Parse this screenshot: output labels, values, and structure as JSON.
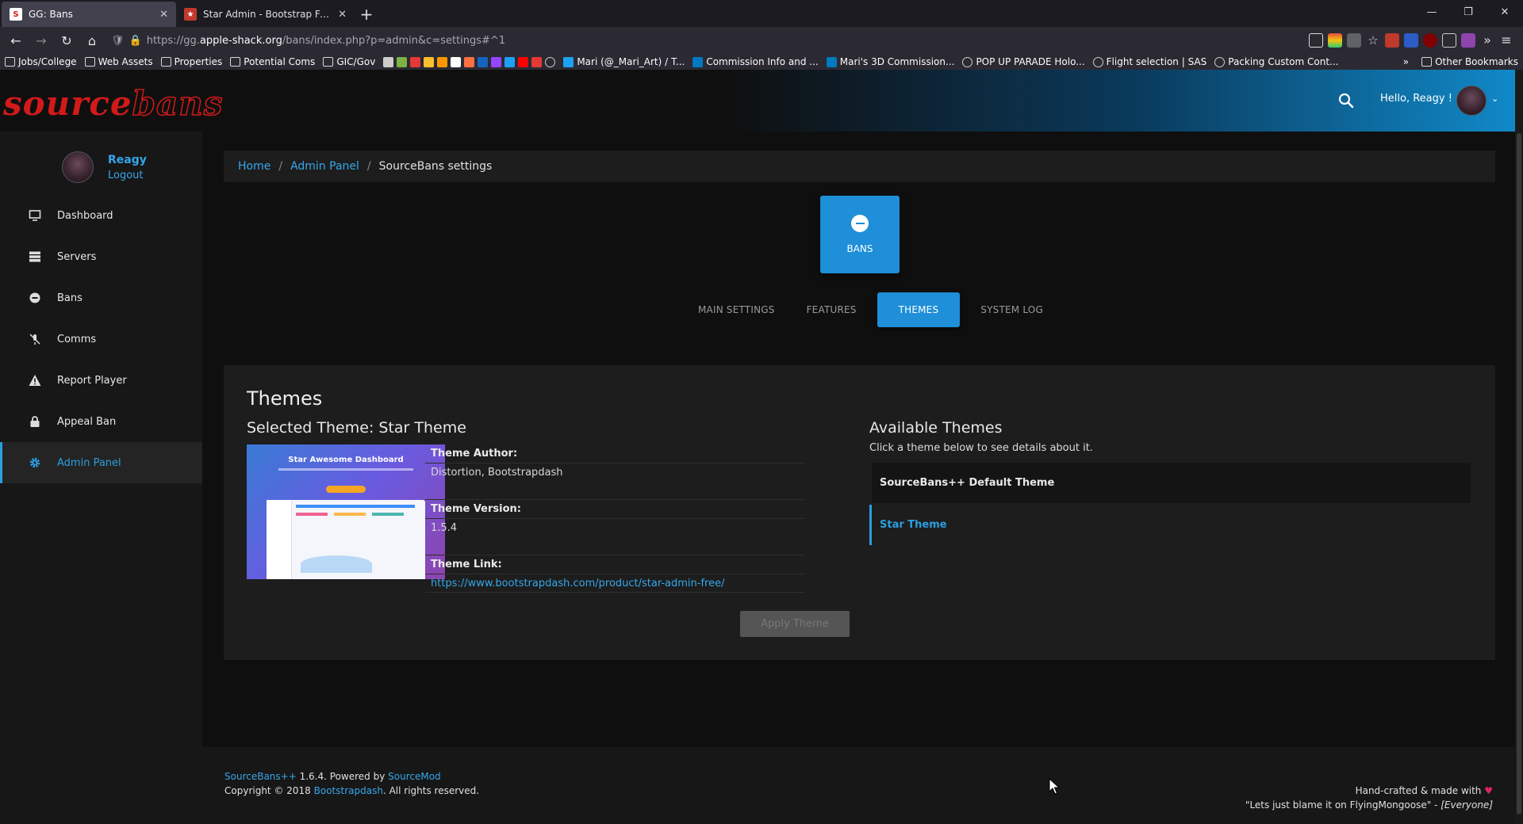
{
  "browser": {
    "tabs": [
      {
        "title": "GG: Bans",
        "active": true
      },
      {
        "title": "Star Admin - Bootstrap Free Adm",
        "active": false
      }
    ],
    "url_prefix": "https://gg.",
    "url_host": "apple-shack.org",
    "url_path": "/bans/index.php?p=admin&c=settings#^1",
    "bookmarks": [
      "Jobs/College",
      "Web Assets",
      "Properties",
      "Potential Coms",
      "GIC/Gov",
      "Mari (@_Mari_Art) / T...",
      "Commission Info and ...",
      "Mari's 3D Commission...",
      "POP UP PARADE Holo...",
      "Flight selection | SAS",
      "Packing Custom Cont..."
    ],
    "other_bookmarks": "Other Bookmarks"
  },
  "header": {
    "logo_source": "source",
    "logo_bans": "bans",
    "greeting": "Hello, Reagy !"
  },
  "sidebar": {
    "user": "Reagy",
    "logout": "Logout",
    "items": [
      {
        "label": "Dashboard",
        "icon": "monitor-icon"
      },
      {
        "label": "Servers",
        "icon": "server-icon"
      },
      {
        "label": "Bans",
        "icon": "ban-icon"
      },
      {
        "label": "Comms",
        "icon": "mute-icon"
      },
      {
        "label": "Report Player",
        "icon": "warning-icon"
      },
      {
        "label": "Appeal Ban",
        "icon": "lock-icon"
      },
      {
        "label": "Admin Panel",
        "icon": "gear-icon",
        "active": true
      }
    ]
  },
  "breadcrumb": {
    "home": "Home",
    "admin": "Admin Panel",
    "current": "SourceBans settings"
  },
  "section_card": {
    "label": "BANS"
  },
  "settings_tabs": [
    "MAIN SETTINGS",
    "FEATURES",
    "THEMES",
    "SYSTEM LOG"
  ],
  "themes": {
    "title": "Themes",
    "selected_title": "Selected Theme: Star Theme",
    "preview_heading": "Star Awesome Dashboard",
    "author_label": "Theme Author:",
    "author": "Distortion, Bootstrapdash",
    "version_label": "Theme Version:",
    "version": "1.5.4",
    "link_label": "Theme Link:",
    "link": "https://www.bootstrapdash.com/product/star-admin-free/",
    "apply_button": "Apply Theme",
    "available_title": "Available Themes",
    "available_sub": "Click a theme below to see details about it.",
    "list": [
      "SourceBans++ Default Theme",
      "Star Theme"
    ]
  },
  "footer": {
    "sb_link": "SourceBans++",
    "version_text": " 1.6.4. Powered by ",
    "sm_link": "SourceMod",
    "copyright": "Copyright © 2018 ",
    "bd_link": "Bootstrapdash",
    "rights": ". All rights reserved.",
    "handcrafted": "Hand-crafted & made with",
    "quote": "\"Lets just blame it on FlyingMongoose\" - ",
    "quote_author": "[Everyone]"
  },
  "colors": {
    "accent": "#1e8fd8",
    "link": "#35a7ea",
    "logo_red": "#d11a1a",
    "panel_bg": "#1d1d1d",
    "sidebar_bg": "#171717"
  }
}
